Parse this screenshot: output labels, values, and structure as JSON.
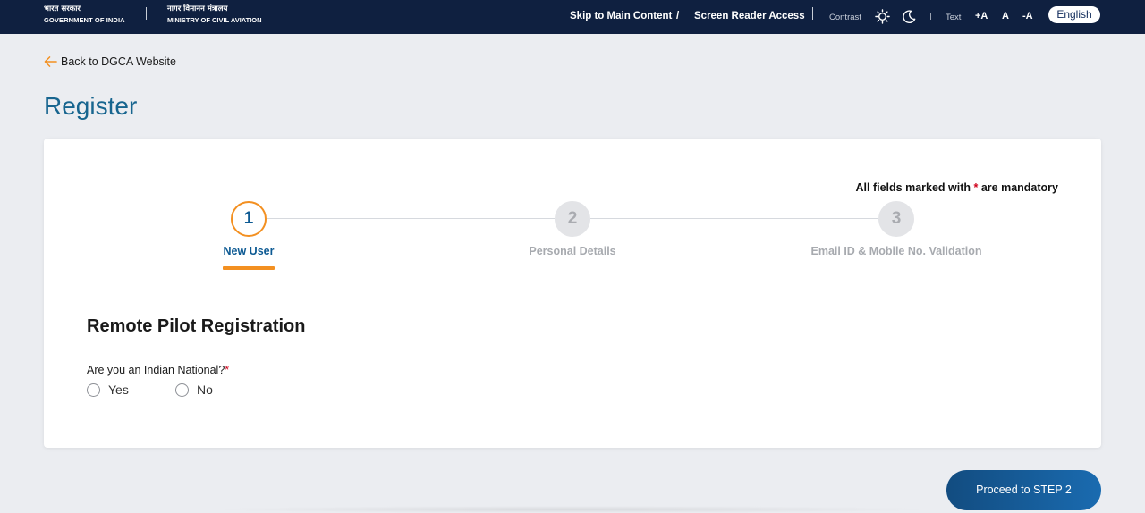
{
  "topbar": {
    "gov_hindi": "भारत सरकार",
    "gov_english": "GOVERNMENT OF INDIA",
    "ministry_hindi": "नागर विमानन मंत्रालय",
    "ministry_english": "MINISTRY OF CIVIL AVIATION",
    "skip_link": "Skip to Main Content",
    "separator": "/",
    "screen_reader": "Screen Reader Access",
    "contrast_label": "Contrast",
    "text_label": "Text",
    "text_increase": "+A",
    "text_normal": "A",
    "text_decrease": "-A",
    "language": "English",
    "icons": [
      "sun-icon",
      "moon-icon"
    ]
  },
  "back_link": {
    "label": "Back to DGCA Website",
    "icon": "arrow-left-icon",
    "icon_color": "#f39021"
  },
  "page_title": "Register",
  "form": {
    "mandatory_prefix": "All fields marked with ",
    "mandatory_star": "*",
    "mandatory_suffix": " are mandatory",
    "steps": [
      {
        "number": "1",
        "label": "New User",
        "state": "active"
      },
      {
        "number": "2",
        "label": "Personal Details",
        "state": "inactive"
      },
      {
        "number": "3",
        "label": "Email ID & Mobile No. Validation",
        "state": "inactive"
      }
    ],
    "section_title": "Remote Pilot Registration",
    "question": "Are you an Indian National?",
    "question_star": "*",
    "options": [
      {
        "label": "Yes",
        "selected": false
      },
      {
        "label": "No",
        "selected": false
      }
    ]
  },
  "proceed_button": "Proceed to STEP 2",
  "colors": {
    "topbar_bg": "#0f2040",
    "accent_orange": "#f39021",
    "primary_blue": "#0d5a93",
    "title_blue": "#17658f",
    "required_red": "#d0021b",
    "page_bg": "#ebedf1"
  }
}
